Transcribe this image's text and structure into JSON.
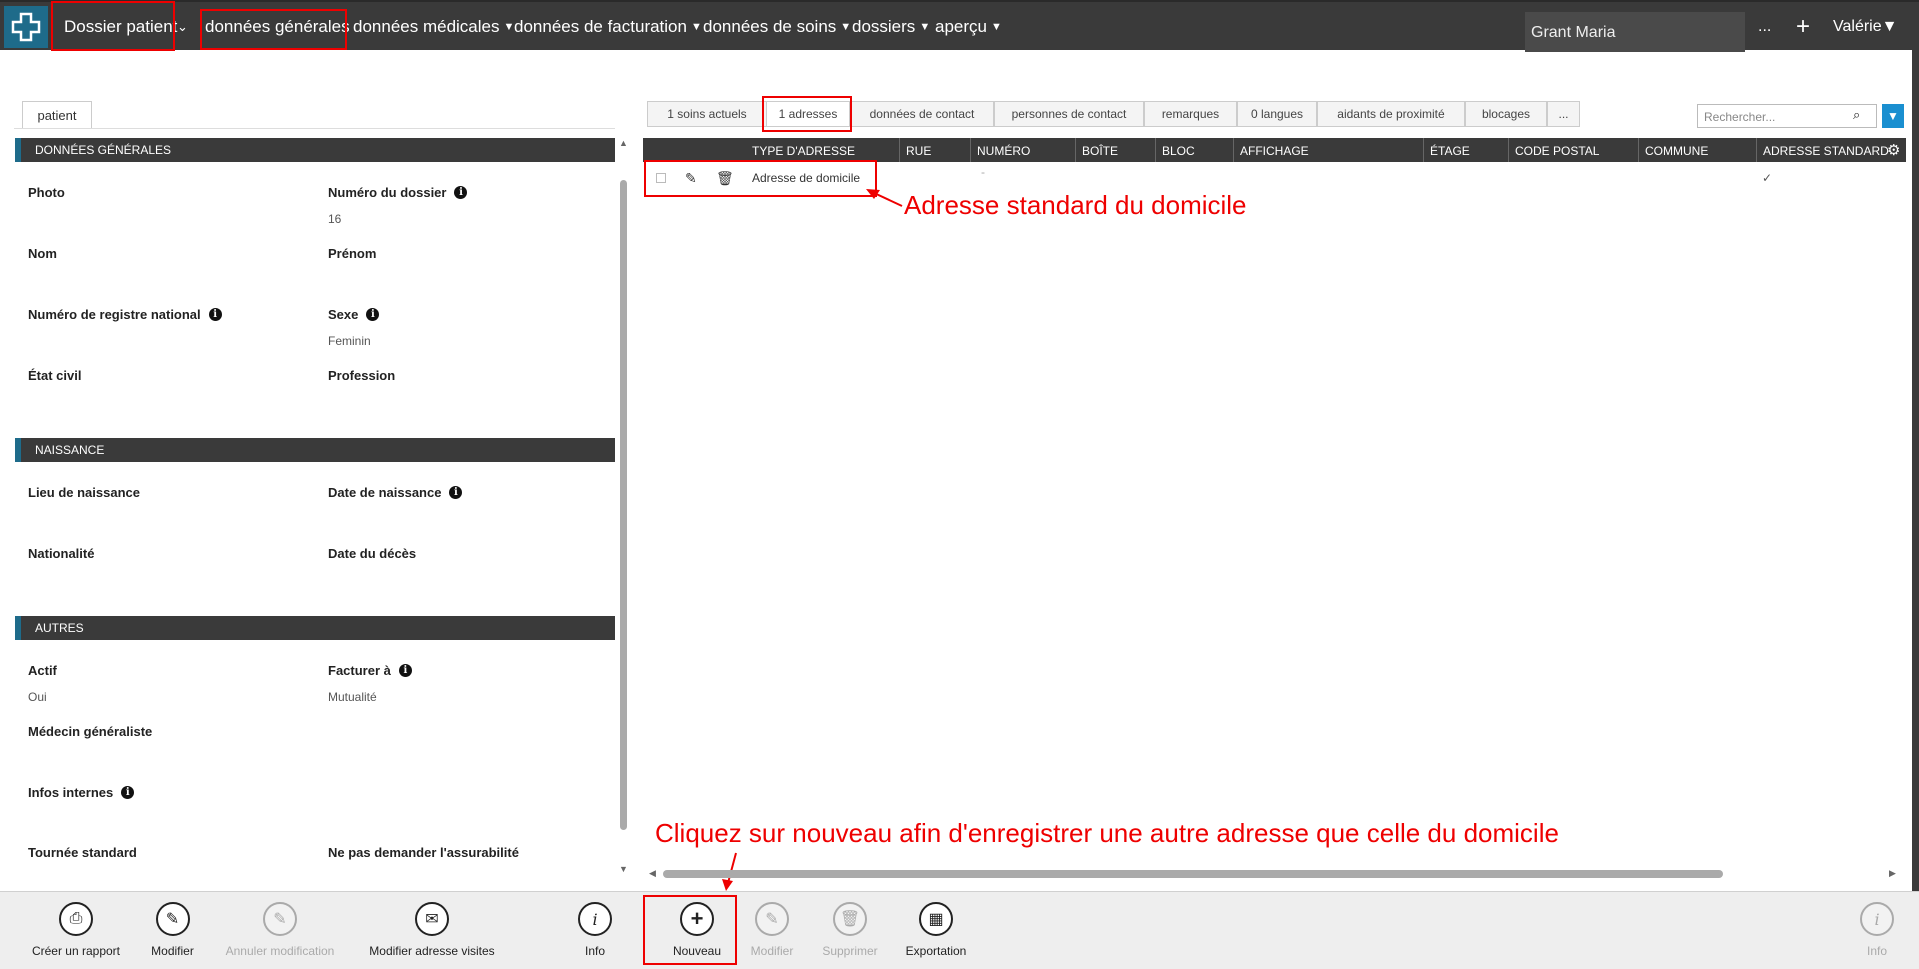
{
  "nav": {
    "menu": [
      "Dossier patient",
      "données générales",
      "données médicales",
      "données de facturation",
      "données de soins",
      "dossiers",
      "aperçu"
    ],
    "patient_name": "Grant Maria",
    "more": "...",
    "add": "+",
    "user": "Valérie"
  },
  "left": {
    "tab": "patient",
    "sections": {
      "general": "DONNÉES GÉNÉRALES",
      "birth": "NAISSANCE",
      "others": "AUTRES"
    },
    "fields": {
      "photo": "Photo",
      "file_number": "Numéro du dossier",
      "file_number_value": "16",
      "name": "Nom",
      "firstname": "Prénom",
      "national_register": "Numéro de registre national",
      "sex": "Sexe",
      "sex_value": "Feminin",
      "civil_status": "État civil",
      "profession": "Profession",
      "birth_place": "Lieu de naissance",
      "birth_date": "Date de naissance",
      "nationality": "Nationalité",
      "death_date": "Date du décès",
      "active": "Actif",
      "active_value": "Oui",
      "bill_to": "Facturer à",
      "bill_to_value": "Mutualité",
      "gp": "Médecin généraliste",
      "internal_info": "Infos internes",
      "standard_round": "Tournée standard",
      "no_insurability": "Ne pas demander l'assurabilité"
    }
  },
  "right": {
    "tabs": [
      "1 soins actuels",
      "1 adresses",
      "données de contact",
      "personnes de contact",
      "remarques",
      "0 langues",
      "aidants de proximité",
      "blocages",
      "..."
    ],
    "search_placeholder": "Rechercher...",
    "columns": [
      "TYPE D'ADRESSE",
      "RUE",
      "NUMÉRO",
      "BOÎTE",
      "BLOC",
      "AFFICHAGE",
      "ÉTAGE",
      "CODE POSTAL",
      "COMMUNE",
      "ADRESSE STANDARD"
    ],
    "rows": [
      {
        "type": "Adresse de domicile",
        "dash": "-",
        "standard": "✓"
      }
    ],
    "annotation_1": "Adresse standard du domicile",
    "annotation_2": "Cliquez sur nouveau afin d'enregistrer une autre adresse que celle du domicile"
  },
  "toolbar": {
    "create_report": "Créer un rapport",
    "modify": "Modifier",
    "cancel_modification": "Annuler modification",
    "modify_visit_address": "Modifier adresse visites",
    "info": "Info",
    "new": "Nouveau",
    "modify_right": "Modifier",
    "delete": "Supprimer",
    "export": "Exportation",
    "info_right": "Info"
  }
}
